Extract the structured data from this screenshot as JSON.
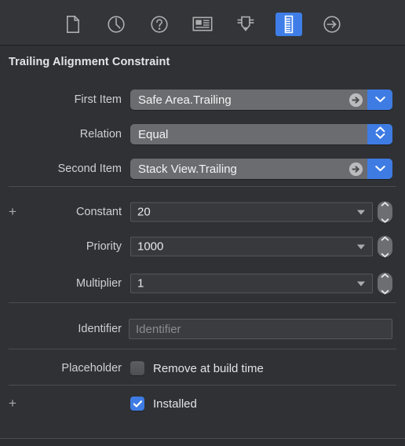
{
  "inspector": {
    "toolbar": {
      "items": [
        {
          "name": "file-icon",
          "title": "File inspector",
          "selected": false
        },
        {
          "name": "clock-icon",
          "title": "History inspector",
          "selected": false
        },
        {
          "name": "help-icon",
          "title": "Quick Help inspector",
          "selected": false
        },
        {
          "name": "identity-icon",
          "title": "Identity inspector",
          "selected": false
        },
        {
          "name": "attributes-icon",
          "title": "Attributes inspector",
          "selected": false
        },
        {
          "name": "ruler-icon",
          "title": "Size inspector",
          "selected": true
        },
        {
          "name": "connections-icon",
          "title": "Connections inspector",
          "selected": false
        }
      ]
    },
    "title": "Trailing Alignment Constraint",
    "rows": {
      "first_item": {
        "label": "First Item",
        "value": "Safe Area.Trailing",
        "detail_icon": "arrow-circle-icon",
        "chevron_icon": "chevron-down-icon"
      },
      "relation": {
        "label": "Relation",
        "value": "Equal",
        "chevron_icon": "chevron-up-down-icon"
      },
      "second_item": {
        "label": "Second Item",
        "value": "Stack View.Trailing",
        "detail_icon": "arrow-circle-icon",
        "chevron_icon": "chevron-down-icon"
      },
      "constant": {
        "label": "Constant",
        "value": "20",
        "add_button": "+",
        "stepper_icon": "stepper-icon"
      },
      "priority": {
        "label": "Priority",
        "value": "1000",
        "stepper_icon": "stepper-icon"
      },
      "multiplier": {
        "label": "Multiplier",
        "value": "1",
        "stepper_icon": "stepper-icon"
      },
      "identifier": {
        "label": "Identifier",
        "value": "",
        "placeholder": "Identifier"
      },
      "placeholder": {
        "label": "Placeholder",
        "checkbox_label": "Remove at build time",
        "checked": false
      },
      "installed": {
        "label": "",
        "checkbox_label": "Installed",
        "checked": true,
        "add_button": "+"
      }
    },
    "colors": {
      "background": "#2f3135",
      "toolbar_background": "#333538",
      "accent": "#3e7ce4",
      "popup_background": "#6a6c70",
      "field_background": "#38393d",
      "separator": "#4a4c50",
      "text": "#d9dadb",
      "placeholder_text": "#8a8c8f"
    }
  }
}
